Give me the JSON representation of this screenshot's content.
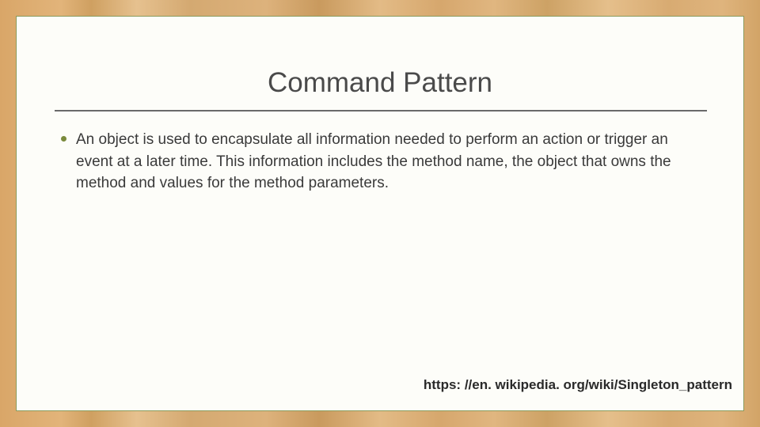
{
  "slide": {
    "title": "Command Pattern",
    "bullets": [
      "An object is used to encapsulate all information needed to perform an action or trigger an event at a later time. This information includes the method name, the object that owns the method and values for the method parameters."
    ],
    "footer_link": "https: //en. wikipedia. org/wiki/Singleton_pattern"
  }
}
